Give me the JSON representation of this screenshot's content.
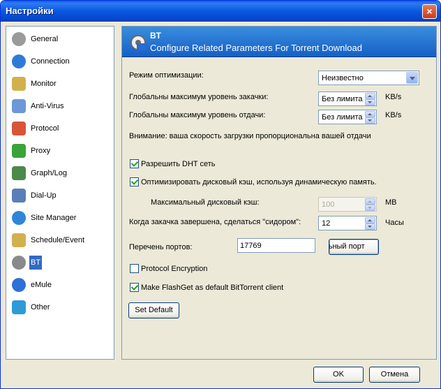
{
  "window": {
    "title": "Настройки",
    "close": "×"
  },
  "sidebar": {
    "items": [
      {
        "label": "General",
        "icon": "gear-icon",
        "color": "#8a8a8a"
      },
      {
        "label": "Connection",
        "icon": "globe-icon",
        "color": "#2f7ad8"
      },
      {
        "label": "Monitor",
        "icon": "monitor-icon",
        "color": "#c8a64a"
      },
      {
        "label": "Anti-Virus",
        "icon": "shield-icon",
        "color": "#5c8fd8"
      },
      {
        "label": "Protocol",
        "icon": "protocol-icon",
        "color": "#d84a2f"
      },
      {
        "label": "Proxy",
        "icon": "proxy-icon",
        "color": "#3aa33a"
      },
      {
        "label": "Graph/Log",
        "icon": "graph-icon",
        "color": "#3e7d3e"
      },
      {
        "label": "Dial-Up",
        "icon": "dialup-icon",
        "color": "#4a6fa8"
      },
      {
        "label": "Site Manager",
        "icon": "site-manager-icon",
        "color": "#2f86d8"
      },
      {
        "label": "Schedule/Event",
        "icon": "schedule-icon",
        "color": "#c8a64a"
      },
      {
        "label": "BT",
        "icon": "bt-gear-icon",
        "color": "#7a7a7a",
        "selected": true
      },
      {
        "label": "eMule",
        "icon": "emule-icon",
        "color": "#2f6fd8"
      },
      {
        "label": "Other",
        "icon": "check-icon",
        "color": "#2f9ad8"
      }
    ]
  },
  "header": {
    "title": "BT",
    "subtitle": "Configure Related Parameters For Torrent Download"
  },
  "form": {
    "opt_mode_label": "Режим оптимизации:",
    "opt_mode_value": "Неизвестно",
    "dl_max_label": "Глобальны максимум уровень закачки:",
    "dl_max_value": "Без лимита",
    "dl_unit": "KB/s",
    "ul_max_label": "Глобальны максимум уровень отдачи:",
    "ul_max_value": "Без лимита",
    "ul_unit": "KB/s",
    "warning": "Внимание: ваша скорость загрузки пропорциональна вашей отдачи",
    "dht_label": "Разрешить DHT сеть",
    "dht_checked": true,
    "cache_label": "Оптимизировать дисковый кэш, используя динамическую память.",
    "cache_checked": true,
    "max_cache_label": "Максимальный дисковый кэш:",
    "max_cache_value": "100",
    "max_cache_unit": "MB",
    "seed_label": "Когда закачка завершена, сделаться \"сидором\":",
    "seed_value": "12",
    "seed_unit": "Часы",
    "ports_label": "Перечень портов:",
    "ports_value": "17769",
    "random_button": "Произвольный порт",
    "encryption_label": "Protocol Encryption",
    "encryption_checked": false,
    "default_client_label": "Make FlashGet as default BitTorrent client",
    "default_client_checked": true,
    "set_default": "Set Default"
  },
  "footer": {
    "ok": "OK",
    "cancel": "Отмена"
  }
}
